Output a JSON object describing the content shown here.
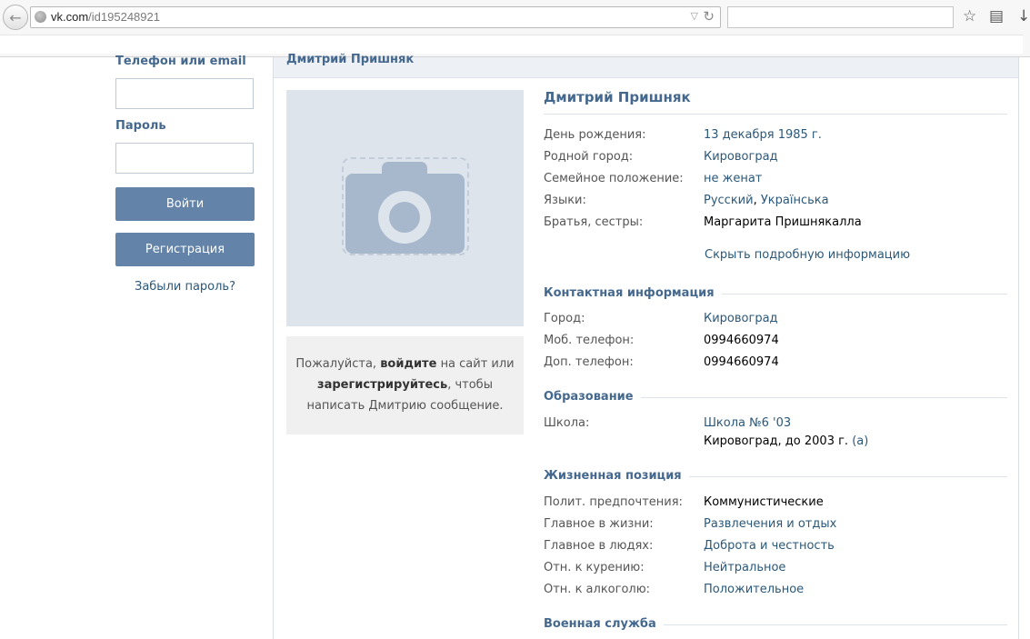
{
  "browser": {
    "url_domain": "vk.com",
    "url_path": "/id195248921"
  },
  "login": {
    "phone_label": "Телефон или email",
    "password_label": "Пароль",
    "login_button": "Войти",
    "register_button": "Регистрация",
    "forgot_link": "Забыли пароль?"
  },
  "profile": {
    "header_name": "Дмитрий Пришняк",
    "name": "Дмитрий Пришняк",
    "message_prefix": "Пожалуйста,",
    "message_login": "войдите",
    "message_mid": "на сайт или",
    "message_register": "зарегистрируйтесь",
    "message_suffix": ", чтобы написать Дмитрию сообщение.",
    "info": {
      "birthday_label": "День рождения:",
      "birthday_value": "13 декабря 1985 г.",
      "hometown_label": "Родной город:",
      "hometown_value": "Кировоград",
      "marital_label": "Семейное положение:",
      "marital_value": "не женат",
      "languages_label": "Языки:",
      "language_1": "Русский",
      "language_sep": ",",
      "language_2": "Українська",
      "siblings_label": "Братья, сестры:",
      "siblings_value": "Маргарита Пришнякалла",
      "hide_link": "Скрыть подробную информацию"
    },
    "contacts": {
      "title": "Контактная информация",
      "city_label": "Город:",
      "city_value": "Кировоград",
      "mobile_label": "Моб. телефон:",
      "mobile_value": "0994660974",
      "extra_label": "Доп. телефон:",
      "extra_value": "0994660974"
    },
    "education": {
      "title": "Образование",
      "school_label": "Школа:",
      "school_value": "Школа №6 '03",
      "school_detail": "Кировоград, до 2003 г.",
      "school_class": "(а)"
    },
    "life_position": {
      "title": "Жизненная позиция",
      "politics_label": "Полит. предпочтения:",
      "politics_value": "Коммунистические",
      "main_life_label": "Главное в жизни:",
      "main_life_value": "Развлечения и отдых",
      "main_people_label": "Главное в людях:",
      "main_people_value": "Доброта и честность",
      "smoking_label": "Отн. к курению:",
      "smoking_value": "Нейтральное",
      "alcohol_label": "Отн. к алкоголю:",
      "alcohol_value": "Положительное"
    },
    "military": {
      "title": "Военная служба"
    }
  }
}
